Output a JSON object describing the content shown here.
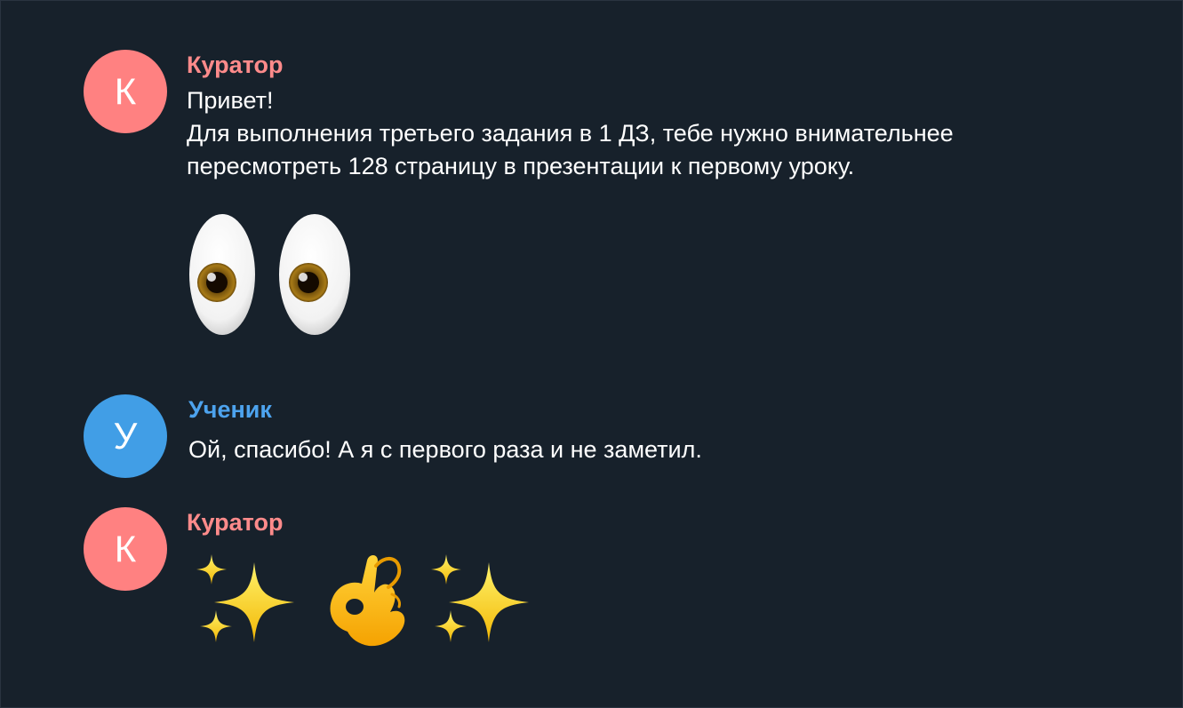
{
  "messages": [
    {
      "sender": "Куратор",
      "avatar_letter": "К",
      "avatar_color": "#ff8181",
      "name_color": "#ff8b8b",
      "lines": [
        "Привет!",
        "Для выполнения третьего задания в 1 ДЗ, тебе нужно внимательнее",
        "пересмотреть 128 страницу в презентации к первому уроку."
      ],
      "emoji": "eyes"
    },
    {
      "sender": "Ученик",
      "avatar_letter": "У",
      "avatar_color": "#419ee6",
      "name_color": "#4da3ee",
      "lines": [
        "Ой, спасибо! А я с первого раза и не заметил."
      ]
    },
    {
      "sender": "Куратор",
      "avatar_letter": "К",
      "avatar_color": "#ff8181",
      "name_color": "#ff8b8b",
      "emoji": [
        "sparkles",
        "ok-hand",
        "sparkles"
      ]
    }
  ]
}
